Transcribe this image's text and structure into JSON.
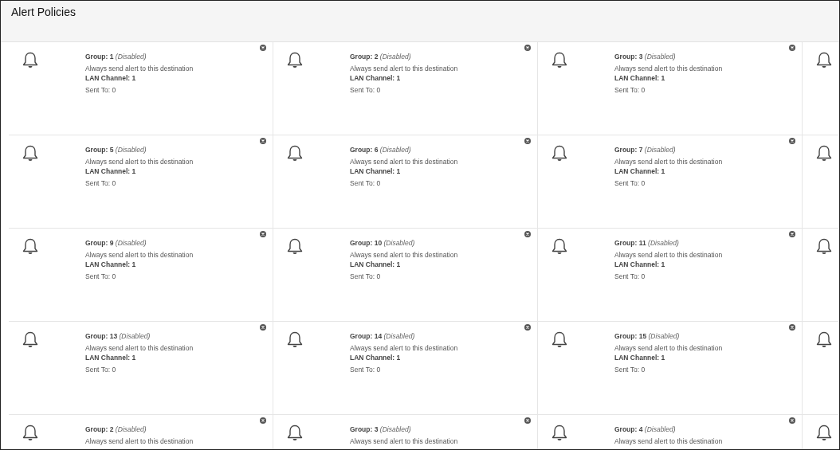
{
  "title": "Alert Policies",
  "rows": [
    {
      "cards": [
        {
          "kind": "policy",
          "heading": "**Group: 1** *(Disabled)*",
          "description": "Always send alert to this destination",
          "channel": "LAN Channel: 1",
          "sent_to": "Sent To: 0"
        },
        {
          "kind": "policy",
          "heading": "**Group: 2** *(Disabled)*",
          "description": "Always send alert to this destination",
          "channel": "LAN Channel: 1",
          "sent_to": "Sent To: 0"
        },
        {
          "kind": "policy",
          "heading": "**Group: 3** *(Disabled)*",
          "description": "Always send alert to this destination",
          "channel": "LAN Channel: 1",
          "sent_to": "Sent To: 0"
        },
        {
          "kind": "clipped"
        }
      ]
    },
    {
      "cards": [
        {
          "kind": "policy",
          "heading": "**Group: 5** *(Disabled)*",
          "description": "Always send alert to this destination",
          "channel": "LAN Channel: 1",
          "sent_to": "Sent To: 0"
        },
        {
          "kind": "policy",
          "heading": "**Group: 6** *(Disabled)*",
          "description": "Always send alert to this destination",
          "channel": "LAN Channel: 1",
          "sent_to": "Sent To: 0"
        },
        {
          "kind": "policy",
          "heading": "**Group: 7** *(Disabled)*",
          "description": "Always send alert to this destination",
          "channel": "LAN Channel: 1",
          "sent_to": "Sent To: 0"
        },
        {
          "kind": "clipped"
        }
      ]
    },
    {
      "cards": [
        {
          "kind": "policy",
          "heading": "**Group: 9** *(Disabled)*",
          "description": "Always send alert to this destination",
          "channel": "LAN Channel: 1",
          "sent_to": "Sent To: 0"
        },
        {
          "kind": "policy",
          "heading": "**Group: 10** *(Disabled)*",
          "description": "Always send alert to this destination",
          "channel": "LAN Channel: 1",
          "sent_to": "Sent To: 0"
        },
        {
          "kind": "policy",
          "heading": "**Group: 11** *(Disabled)*",
          "description": "Always send alert to this destination",
          "channel": "LAN Channel: 1",
          "sent_to": "Sent To: 0"
        },
        {
          "kind": "clipped"
        }
      ]
    },
    {
      "cards": [
        {
          "kind": "policy",
          "heading": "**Group: 13** *(Disabled)*",
          "description": "Always send alert to this destination",
          "channel": "LAN Channel: 1",
          "sent_to": "Sent To: 0"
        },
        {
          "kind": "policy",
          "heading": "**Group: 14** *(Disabled)*",
          "description": "Always send alert to this destination",
          "channel": "LAN Channel: 1",
          "sent_to": "Sent To: 0"
        },
        {
          "kind": "policy",
          "heading": "**Group: 15** *(Disabled)*",
          "description": "Always send alert to this destination",
          "channel": "LAN Channel: 1",
          "sent_to": "Sent To: 0"
        },
        {
          "kind": "clipped"
        }
      ]
    },
    {
      "cards": [
        {
          "kind": "policy",
          "heading": "**Group: 2** *(Disabled)*",
          "description": "Always send alert to this destination"
        },
        {
          "kind": "policy",
          "heading": "**Group: 3** *(Disabled)*",
          "description": "Always send alert to this destination"
        },
        {
          "kind": "policy",
          "heading": "**Group: 4** *(Disabled)*",
          "description": "Always send alert to this destination"
        },
        {
          "kind": "clipped"
        }
      ]
    }
  ]
}
